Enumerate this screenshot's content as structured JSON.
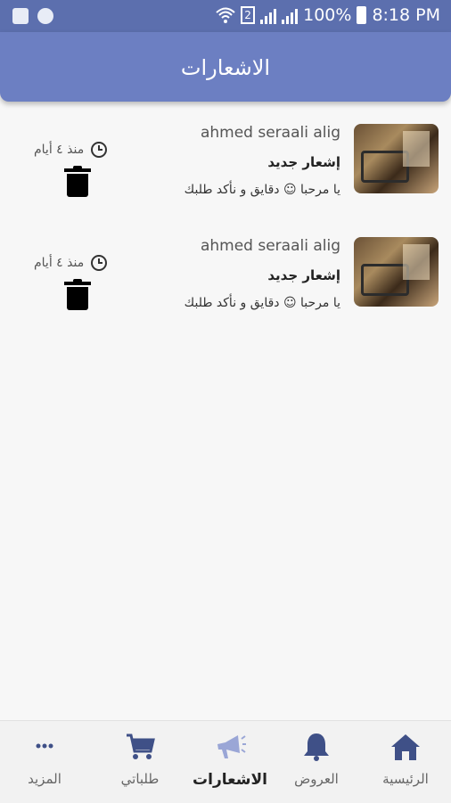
{
  "status_bar": {
    "sim": "2",
    "battery": "100%",
    "time": "8:18 PM"
  },
  "header": {
    "title": "الاشعارات"
  },
  "notifications": [
    {
      "sender": "ahmed seraali alig",
      "title": "إشعار جديد",
      "body": "يا مرحبا ☺ دقايق و نأكد طلبك",
      "time": "منذ ٤ أيام"
    },
    {
      "sender": "ahmed seraali alig",
      "title": "إشعار جديد",
      "body": "يا مرحبا ☺ دقايق و نأكد طلبك",
      "time": "منذ ٤ أيام"
    }
  ],
  "bottom_nav": {
    "items": [
      {
        "label": "الرئيسية",
        "icon": "home-icon"
      },
      {
        "label": "العروض",
        "icon": "bell-icon"
      },
      {
        "label": "الاشعارات",
        "icon": "megaphone-icon"
      },
      {
        "label": "طلباتي",
        "icon": "cart-icon"
      },
      {
        "label": "المزيد",
        "icon": "more-icon"
      }
    ],
    "active_color": "#3f5087"
  }
}
